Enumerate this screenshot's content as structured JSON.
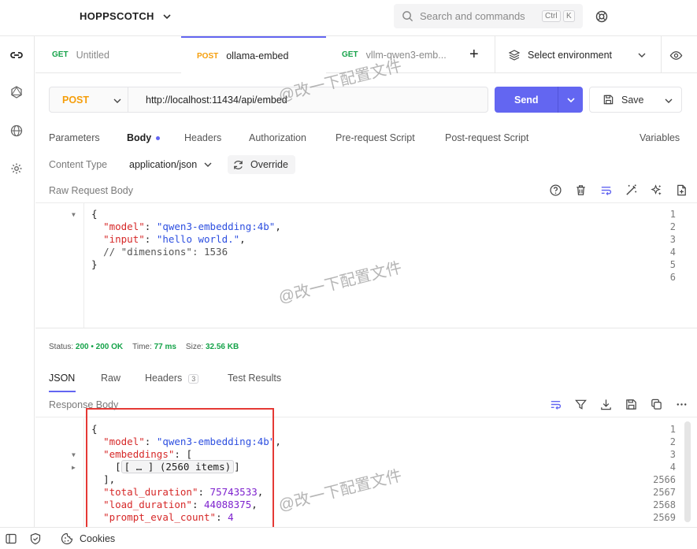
{
  "app": {
    "name": "HOPPSCOTCH",
    "search_placeholder": "Search and commands",
    "shortcut_keys": [
      "Ctrl",
      "K"
    ]
  },
  "tabs": [
    {
      "method": "GET",
      "name": "Untitled",
      "active": false
    },
    {
      "method": "POST",
      "name": "ollama-embed",
      "active": true
    },
    {
      "method": "GET",
      "name": "vllm-qwen3-emb...",
      "active": false
    }
  ],
  "add_tab_label": "+",
  "environment": {
    "label": "Select environment"
  },
  "request": {
    "method": "POST",
    "url": "http://localhost:11434/api/embed",
    "send_label": "Send",
    "save_label": "Save"
  },
  "request_tabs": [
    "Parameters",
    "Body",
    "Headers",
    "Authorization",
    "Pre-request Script",
    "Post-request Script"
  ],
  "variables_label": "Variables",
  "content_type": {
    "label": "Content Type",
    "value": "application/json",
    "override_label": "Override"
  },
  "request_body": {
    "title": "Raw Request Body",
    "lines": [
      {
        "no": "1",
        "fold": true,
        "text": "{"
      },
      {
        "no": "2",
        "key": "\"model\"",
        "sep": ": ",
        "value": "\"qwen3-embedding:4b\"",
        "tail": ","
      },
      {
        "no": "3",
        "key": "\"input\"",
        "sep": ": ",
        "value": "\"hello world.\"",
        "tail": ","
      },
      {
        "no": "4",
        "comment": "// \"dimensions\": 1536"
      },
      {
        "no": "5",
        "text": "}"
      },
      {
        "no": "6",
        "text": ""
      }
    ]
  },
  "status": {
    "status_label": "Status:",
    "status_value": "200 • 200 OK",
    "time_label": "Time:",
    "time_value": "77 ms",
    "size_label": "Size:",
    "size_value": "32.56 KB"
  },
  "response_tabs": [
    {
      "label": "JSON",
      "active": true
    },
    {
      "label": "Raw",
      "active": false
    },
    {
      "label": "Headers",
      "badge": "3",
      "active": false
    },
    {
      "label": "Test Results",
      "active": false
    }
  ],
  "response_body": {
    "title": "Response Body",
    "lines": [
      {
        "no": "1",
        "fold": "down",
        "text": "{"
      },
      {
        "no": "2",
        "key": "\"model\"",
        "sep": ": ",
        "value": "\"qwen3-embedding:4b\"",
        "tail": ","
      },
      {
        "no": "3",
        "fold": "down",
        "key": "\"embeddings\"",
        "sep": ": ",
        "text_after": "["
      },
      {
        "no": "4",
        "fold": "right",
        "collapsed": "[ … ]",
        "collapsed_note": "(2560 items)"
      },
      {
        "no": "2566",
        "text": "],"
      },
      {
        "no": "2567",
        "key": "\"total_duration\"",
        "sep": ": ",
        "num": "75743533",
        "tail": ","
      },
      {
        "no": "2568",
        "key": "\"load_duration\"",
        "sep": ": ",
        "num": "44088375",
        "tail": ","
      },
      {
        "no": "2569",
        "key": "\"prompt_eval_count\"",
        "sep": ": ",
        "num": "4"
      }
    ]
  },
  "footer": {
    "cookies_label": "Cookies"
  },
  "watermark": "@改一下配置文件",
  "colors": {
    "accent": "#6366f1",
    "post": "#f59e0b",
    "get": "#16a34a",
    "highlight_box": "#e53935"
  }
}
